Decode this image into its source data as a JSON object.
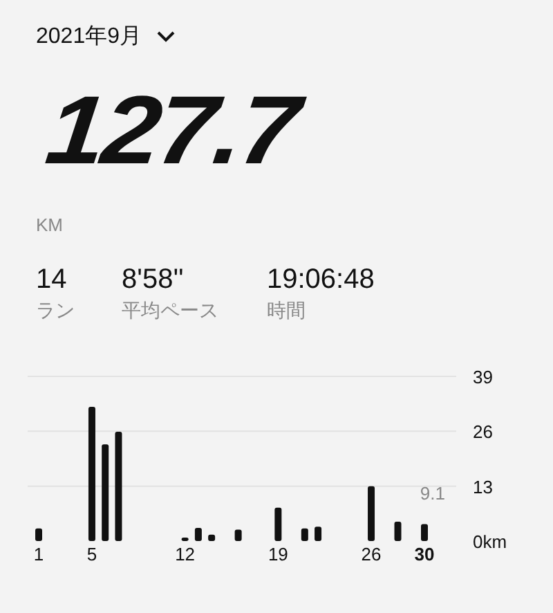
{
  "period_selector": {
    "label": "2021年9月"
  },
  "total": {
    "value": "127.7",
    "unit": "KM"
  },
  "stats": [
    {
      "value": "14",
      "label": "ラン"
    },
    {
      "value": "8'58''",
      "label": "平均ペース"
    },
    {
      "value": "19:06:48",
      "label": "時間"
    }
  ],
  "chart": {
    "highlighted_xtick": "30",
    "average_label": "9.1",
    "chart_data": {
      "type": "bar",
      "x": [
        1,
        2,
        3,
        4,
        5,
        6,
        7,
        8,
        9,
        10,
        11,
        12,
        13,
        14,
        15,
        16,
        17,
        18,
        19,
        20,
        21,
        22,
        23,
        24,
        25,
        26,
        27,
        28,
        29,
        30
      ],
      "values": [
        3.0,
        null,
        null,
        null,
        31.8,
        22.9,
        25.9,
        null,
        null,
        null,
        null,
        0.8,
        3.1,
        1.5,
        null,
        2.7,
        null,
        null,
        7.9,
        null,
        3.0,
        3.4,
        null,
        null,
        null,
        13.0,
        null,
        4.6,
        null,
        4.0
      ],
      "xlim": [
        1,
        30
      ],
      "ylim": [
        0,
        39
      ],
      "xticks": [
        1,
        5,
        12,
        19,
        26,
        30
      ],
      "yticks": [
        {
          "value": 0,
          "label": "0km"
        },
        13,
        26,
        39
      ]
    }
  }
}
